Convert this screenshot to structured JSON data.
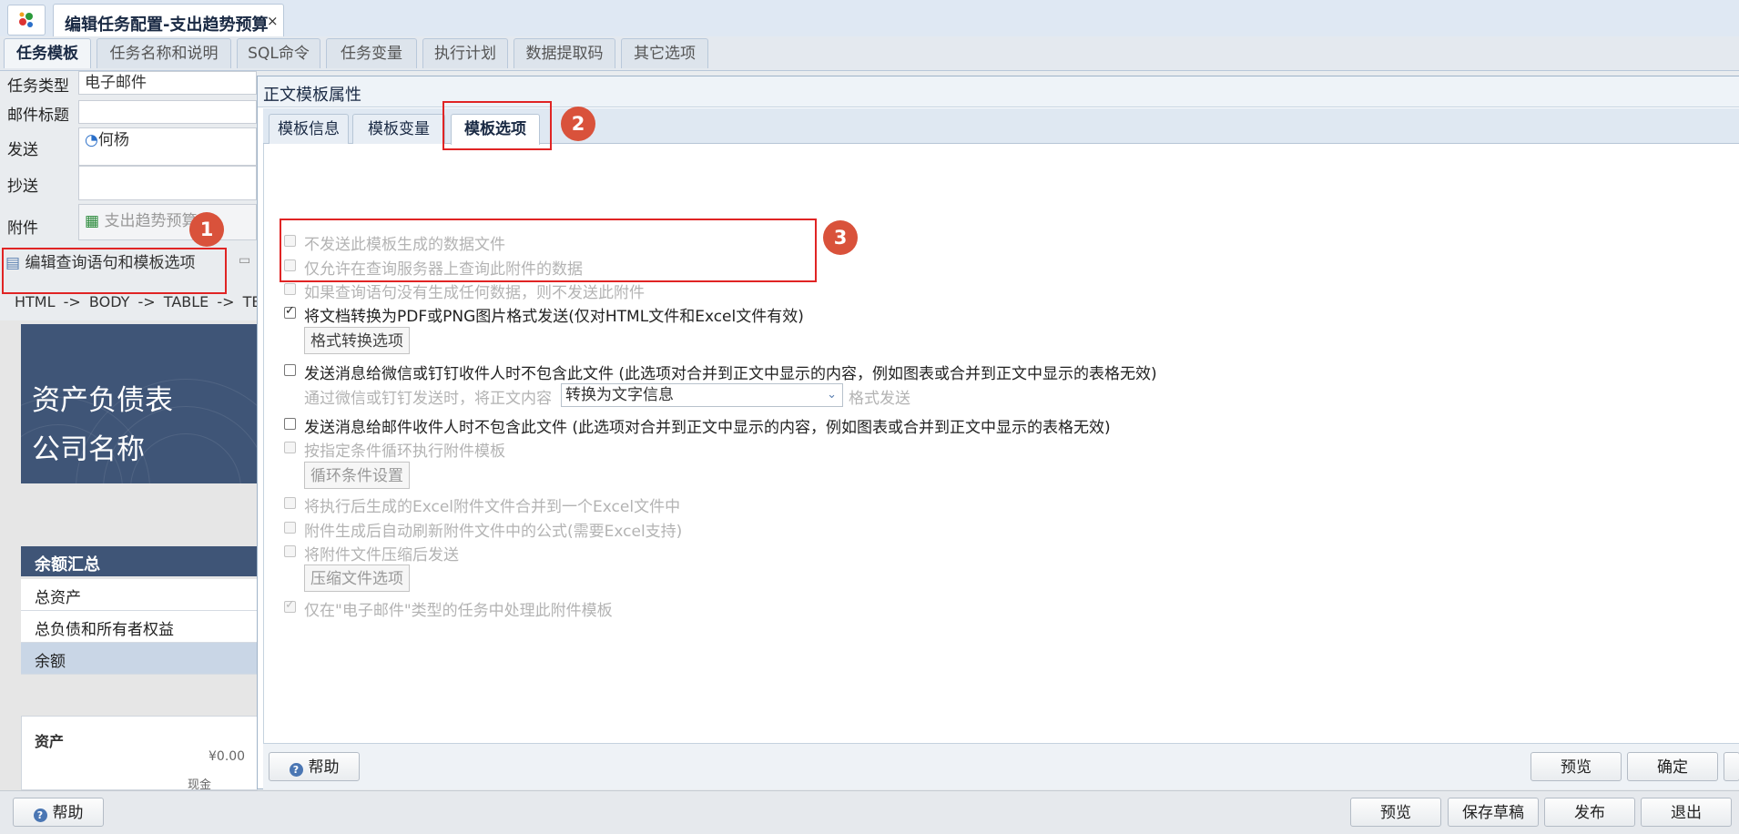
{
  "window": {
    "doc_tab_title": "编辑任务配置-支出趋势预算",
    "close_glyph": "×"
  },
  "main_tabs": [
    "任务模板",
    "任务名称和说明",
    "SQL命令",
    "任务变量",
    "执行计划",
    "数据提取码",
    "其它选项"
  ],
  "form": {
    "task_type_label": "任务类型",
    "task_type_value": "电子邮件",
    "subject_label": "邮件标题",
    "subject_value": "",
    "send_label": "发送",
    "send_value": "何杨",
    "cc_label": "抄送",
    "cc_value": "",
    "attach_label": "附件",
    "attach_value": "支出趋势预算",
    "edit_query_button": "编辑查询语句和模板选项",
    "path": [
      "HTML",
      "->",
      "BODY",
      "->",
      "TABLE",
      "->",
      "TB"
    ]
  },
  "preview": {
    "banner_line1": "资产负债表",
    "banner_line2": "公司名称",
    "summary_title": "余额汇总",
    "summary_rows": [
      "总资产",
      "总负债和所有者权益",
      "余额"
    ],
    "asset_title": "资产",
    "asset_amount": "¥0.00",
    "cash_label": "现金"
  },
  "dialog": {
    "title": "正文模板属性",
    "tabs": [
      "模板信息",
      "模板变量",
      "模板选项"
    ],
    "active_tab": "模板选项",
    "options": [
      {
        "text": "不发送此模板生成的数据文件",
        "checked": false,
        "enabled": false
      },
      {
        "text": "仅允许在查询服务器上查询此附件的数据",
        "checked": false,
        "enabled": false
      },
      {
        "text": "如果查询语句没有生成任何数据，则不发送此附件",
        "checked": false,
        "enabled": false
      },
      {
        "text": "将文档转换为PDF或PNG图片格式发送(仅对HTML文件和Excel文件有效)",
        "checked": true,
        "enabled": true
      },
      {
        "text": "发送消息给微信或钉钉收件人时不包含此文件  (此选项对合并到正文中显示的内容，例如图表或合并到正文中显示的表格无效)",
        "checked": false,
        "enabled": true
      },
      {
        "text": "发送消息给邮件收件人时不包含此文件  (此选项对合并到正文中显示的内容，例如图表或合并到正文中显示的表格无效)",
        "checked": false,
        "enabled": true
      },
      {
        "text": "按指定条件循环执行附件模板",
        "checked": false,
        "enabled": false
      },
      {
        "text": "将执行后生成的Excel附件文件合并到一个Excel文件中",
        "checked": false,
        "enabled": false
      },
      {
        "text": "附件生成后自动刷新附件文件中的公式(需要Excel支持)",
        "checked": false,
        "enabled": false
      },
      {
        "text": "将附件文件压缩后发送",
        "checked": false,
        "enabled": false
      },
      {
        "text": "仅在\"电子邮件\"类型的任务中处理此附件模板",
        "checked": true,
        "enabled": false
      }
    ],
    "format_convert_button": "格式转换选项",
    "wechat_prefix": "通过微信或钉钉发送时，将正文内容",
    "wechat_select_value": "转换为文字信息",
    "wechat_suffix": "格式发送",
    "loop_button": "循环条件设置",
    "compress_button": "压缩文件选项",
    "help_button": "帮助",
    "preview_button": "预览",
    "ok_button": "确定"
  },
  "bottom": {
    "help_button": "帮助",
    "preview_button": "预览",
    "save_draft_button": "保存草稿",
    "publish_button": "发布",
    "exit_button": "退出"
  },
  "annotations": [
    "1",
    "2",
    "3"
  ],
  "colors": {
    "highlight": "#e02424",
    "badge": "#d9523b",
    "banner": "#3f5577"
  }
}
